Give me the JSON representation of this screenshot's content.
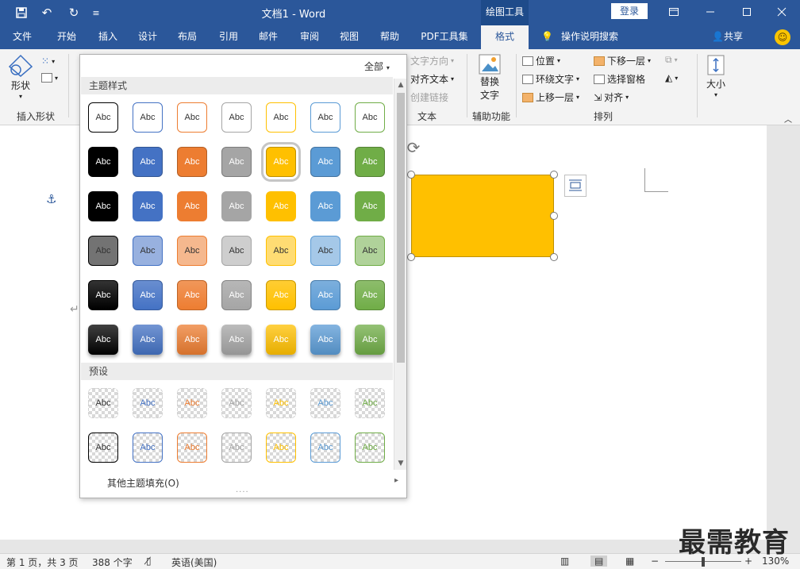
{
  "titlebar": {
    "doc_title": "文档1  -  Word",
    "context_tab": "绘图工具",
    "login": "登录",
    "quick_access": [
      "save-icon",
      "undo-icon",
      "redo-icon",
      "customize-icon"
    ],
    "window_buttons": [
      "ribbon-display-icon",
      "minimize-icon",
      "maximize-icon",
      "close-icon"
    ]
  },
  "tabs": [
    "文件",
    "开始",
    "插入",
    "设计",
    "布局",
    "引用",
    "邮件",
    "审阅",
    "视图",
    "帮助",
    "PDF工具集",
    "格式"
  ],
  "active_tab": "格式",
  "tell_me": "操作说明搜索",
  "share": "共享",
  "ribbon": {
    "insert_shape": {
      "shape_label": "形状",
      "group_label": "插入形状"
    },
    "text": {
      "direction": "文字方向",
      "align": "对齐文本",
      "link": "创建链接",
      "group_label": "文本"
    },
    "alt_text": {
      "line1": "替换",
      "line2": "文字",
      "group_label": "辅助功能"
    },
    "arrange": {
      "position": "位置",
      "wrap": "环绕文字",
      "forward": "上移一层",
      "backward": "下移一层",
      "selection_pane": "选择窗格",
      "align": "对齐",
      "group_label": "排列"
    },
    "size": {
      "label": "大小"
    }
  },
  "gallery": {
    "filter": "全部",
    "theme_section": "主题样式",
    "preset_section": "预设",
    "swatch_text": "Abc",
    "palette": [
      "#000000",
      "#4472c4",
      "#ed7d31",
      "#a5a5a5",
      "#ffc000",
      "#5b9bd5",
      "#70ad47"
    ],
    "selected": {
      "row": 1,
      "col": 4
    },
    "more_fill": "其他主题填充(O)"
  },
  "document": {
    "shape_fill": "#ffc000"
  },
  "status": {
    "page": "第 1 页，共 3 页",
    "words": "388 个字",
    "language": "英语(美国)",
    "zoom": "130%"
  },
  "watermark": "最需教育"
}
